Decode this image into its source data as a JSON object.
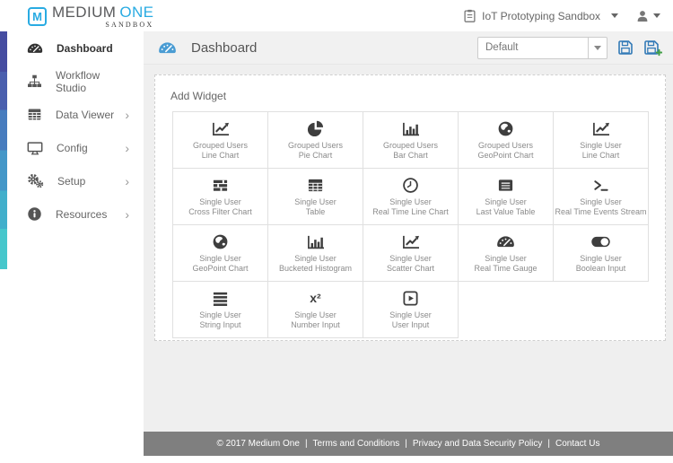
{
  "brand": {
    "logo_letter": "M",
    "name_primary": "MEDIUM",
    "name_accent": "ONE",
    "subtitle": "SANDBOX"
  },
  "topbar": {
    "project_label": "IoT Prototyping Sandbox"
  },
  "sidebar": {
    "chevron_glyph": "›",
    "items": [
      {
        "label": "Dashboard",
        "icon": "gauge-icon",
        "active": true,
        "chevron": false
      },
      {
        "label": "Workflow Studio",
        "icon": "sitemap-icon",
        "active": false,
        "chevron": false
      },
      {
        "label": "Data Viewer",
        "icon": "table-icon",
        "active": false,
        "chevron": true
      },
      {
        "label": "Config",
        "icon": "desktop-icon",
        "active": false,
        "chevron": true
      },
      {
        "label": "Setup",
        "icon": "gears-icon",
        "active": false,
        "chevron": true
      },
      {
        "label": "Resources",
        "icon": "info-circle-icon",
        "active": false,
        "chevron": true
      }
    ]
  },
  "header": {
    "title": "Dashboard",
    "select_value": "Default"
  },
  "widgets": {
    "panel_title": "Add Widget",
    "glyphs": {
      "number_input": "x²"
    },
    "items": [
      {
        "group": "Grouped Users",
        "type": "Line Chart",
        "icon": "line-chart-icon"
      },
      {
        "group": "Grouped Users",
        "type": "Pie Chart",
        "icon": "pie-chart-icon"
      },
      {
        "group": "Grouped Users",
        "type": "Bar Chart",
        "icon": "bar-chart-icon"
      },
      {
        "group": "Grouped Users",
        "type": "GeoPoint Chart",
        "icon": "globe-icon"
      },
      {
        "group": "Single User",
        "type": "Line Chart",
        "icon": "line-chart-icon"
      },
      {
        "group": "Single User",
        "type": "Cross Filter Chart",
        "icon": "cross-filter-icon"
      },
      {
        "group": "Single User",
        "type": "Table",
        "icon": "table-icon"
      },
      {
        "group": "Single User",
        "type": "Real Time Line Chart",
        "icon": "clock-icon"
      },
      {
        "group": "Single User",
        "type": "Last Value Table",
        "icon": "list-alt-icon"
      },
      {
        "group": "Single User",
        "type": "Real Time Events Stream",
        "icon": "terminal-icon"
      },
      {
        "group": "Single User",
        "type": "GeoPoint Chart",
        "icon": "globe-icon"
      },
      {
        "group": "Single User",
        "type": "Bucketed Histogram",
        "icon": "histogram-icon"
      },
      {
        "group": "Single User",
        "type": "Scatter Chart",
        "icon": "scatter-chart-icon"
      },
      {
        "group": "Single User",
        "type": "Real Time Gauge",
        "icon": "gauge-icon"
      },
      {
        "group": "Single User",
        "type": "Boolean Input",
        "icon": "toggle-on-icon"
      },
      {
        "group": "Single User",
        "type": "String Input",
        "icon": "align-justify-icon"
      },
      {
        "group": "Single User",
        "type": "Number Input",
        "icon": "x-squared-icon"
      },
      {
        "group": "Single User",
        "type": "User Input",
        "icon": "play-square-icon"
      }
    ]
  },
  "footer": {
    "copyright": "© 2017 Medium One",
    "divider": "|",
    "links": [
      "Terms and Conditions",
      "Privacy and Data Security Policy",
      "Contact Us"
    ]
  },
  "colors": {
    "accent_blue": "#29ABE2",
    "header_icon_blue": "#4A9CD3",
    "save_blue": "#337AB7",
    "plus_green": "#43A047",
    "footer_bg": "#7F7F7F",
    "strip_gradient_top": "#454CA0",
    "strip_gradient_bottom": "#46C7CC"
  }
}
